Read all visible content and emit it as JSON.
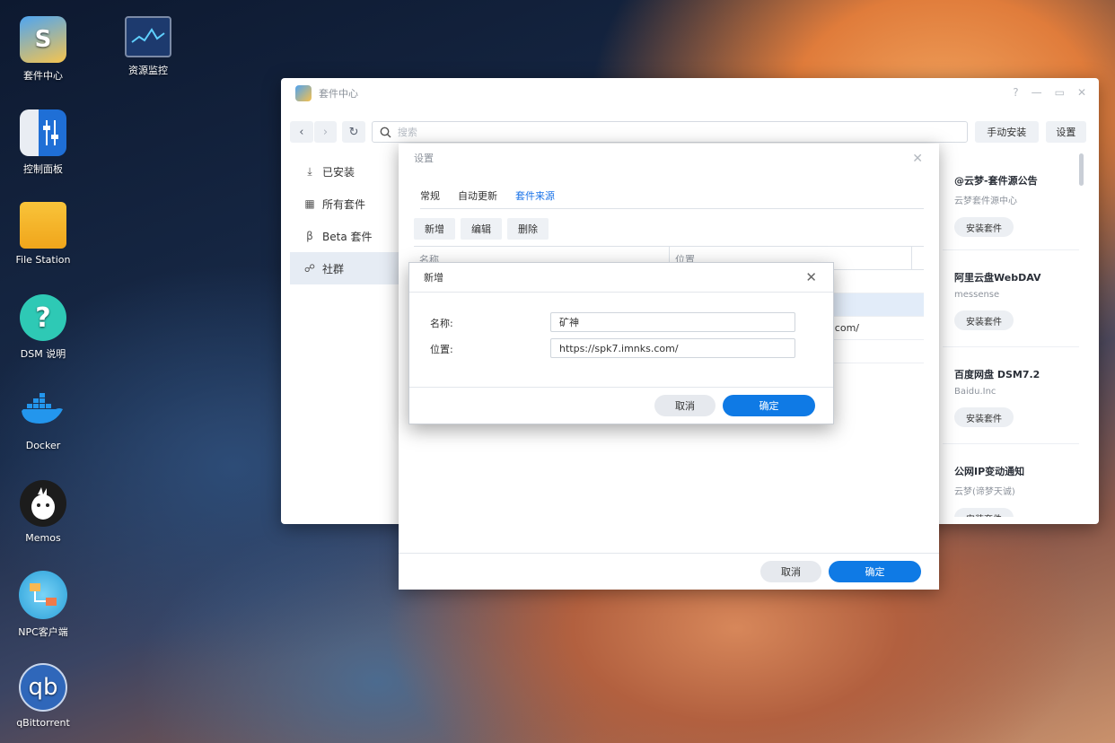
{
  "desktop": {
    "icons": [
      {
        "label": "套件中心",
        "icon": "package-center-icon"
      },
      {
        "label": "资源监控",
        "icon": "resource-monitor-icon"
      },
      {
        "label": "控制面板",
        "icon": "control-panel-icon"
      },
      {
        "label": "File Station",
        "icon": "folder-icon"
      },
      {
        "label": "DSM 说明",
        "icon": "help-icon"
      },
      {
        "label": "Docker",
        "icon": "docker-icon"
      },
      {
        "label": "Memos",
        "icon": "memos-icon"
      },
      {
        "label": "NPC客户端",
        "icon": "npc-client-icon"
      },
      {
        "label": "qBittorrent",
        "icon": "qbittorrent-icon"
      }
    ]
  },
  "window": {
    "title": "套件中心",
    "search_placeholder": "搜索",
    "manual_install": "手动安装",
    "settings": "设置",
    "sidebar": [
      {
        "label": "已安装",
        "icon": "download-icon"
      },
      {
        "label": "所有套件",
        "icon": "grid-icon"
      },
      {
        "label": "Beta 套件",
        "icon": "beta-icon"
      },
      {
        "label": "社群",
        "icon": "community-icon"
      }
    ],
    "packages": [
      {
        "name": "@云梦-套件源公告",
        "author": "云梦套件源中心",
        "button": "安装套件"
      },
      {
        "name": "阿里云盘WebDAV",
        "author": "messense",
        "button": "安装套件"
      },
      {
        "name": "百度网盘 DSM7.2",
        "author": "Baidu.Inc",
        "button": "安装套件"
      },
      {
        "name": "公网IP变动通知",
        "author": "云梦(谛梦天诚)",
        "button": "安装套件"
      }
    ]
  },
  "settings_dialog": {
    "title": "设置",
    "tabs": [
      "常规",
      "自动更新",
      "套件来源"
    ],
    "active_tab": "套件来源",
    "toolbar": [
      "新增",
      "编辑",
      "删除"
    ],
    "columns": [
      "名称",
      "位置"
    ],
    "row_visible_text": "ity.com/",
    "cancel": "取消",
    "ok": "确定"
  },
  "add_dialog": {
    "title": "新增",
    "name_label": "名称:",
    "name_value": "矿神",
    "location_label": "位置:",
    "location_value": "https://spk7.imnks.com/",
    "cancel": "取消",
    "ok": "确定"
  },
  "colors": {
    "accent": "#0f7ae5",
    "active_tab": "#1a73e8"
  }
}
